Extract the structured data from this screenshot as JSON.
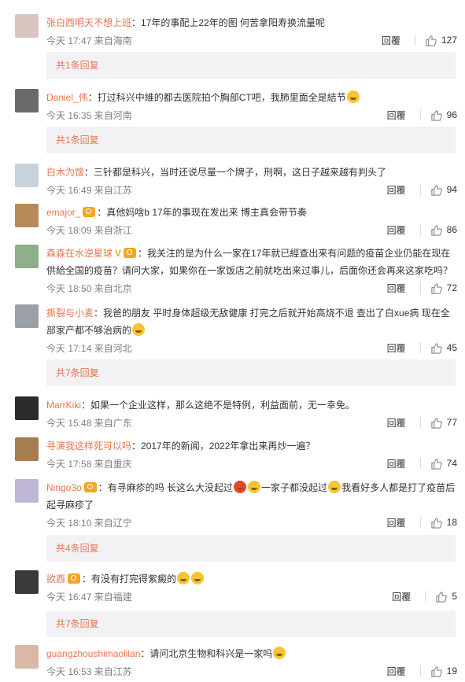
{
  "comments": [
    {
      "user": "张白西明天不想上班",
      "text": "：17年的事配上22年的图 何苦拿阳寿换流量呢",
      "time": "今天 17:47 来自海南",
      "reply": "回覆",
      "likes": "127",
      "more": "共1条回复"
    },
    {
      "user": "Daniel_伟",
      "text": "：打过科兴中維的都去医院拍个胸部CT吧，我肺里面全是結节",
      "time": "今天 16:35 来自河南",
      "reply": "回覆",
      "likes": "96",
      "more": "共1条回复"
    },
    {
      "user": "白木为馊",
      "text": "：三针都是科兴，当时还说尽量一个牌子，刑啊，这日子越来越有判头了",
      "time": "今天 16:49 来自江苏",
      "reply": "回覆",
      "likes": "94"
    },
    {
      "user": "emajor_",
      "text": "：真他妈啥b 17年的事现在发出来 博主真会带节奏",
      "time": "今天 18:09 来自浙江",
      "reply": "回覆",
      "likes": "86"
    },
    {
      "user": "森森在水逆星球",
      "text": "：我关注的是为什么一家在17年就已經查出来有问题的疫苗企业仍能在现在供給全国的疫苗？请问大家，如果你在一家饭店之前就吃出来过事儿，后面你还会再来这家吃吗？",
      "time": "今天 18:50 来自北京",
      "reply": "回覆",
      "likes": "72"
    },
    {
      "user": "撕裂与小麦",
      "text": "：我爸的朋友 平时身体超级无敌健康 打完之后就开始高烧不退 查出了白xue病 现在全部家产都不够治病的",
      "time": "今天 17:14 来自河北",
      "reply": "回覆",
      "likes": "45",
      "more": "共7条回复"
    },
    {
      "user": "MarrKiki",
      "text": "：如果一个企业这样，那么这绝不是特例，利益面前，无一幸免。",
      "time": "今天 15:48 来自广东",
      "reply": "回覆",
      "likes": "77"
    },
    {
      "user": "寻演我这样死可以吗",
      "text": "：2017年的新闻，2022年拿出来再炒一遍？",
      "time": "今天 17:58 来自重庆",
      "reply": "回覆",
      "likes": "74"
    },
    {
      "user": "Ningo3o",
      "text": "：有寻麻疹的吗 长这么大没起过",
      "text2": "一家子都没起过",
      "text3": "我看好多人都是打了疫苗后起寻麻疹了",
      "time": "今天 18:10 来自辽宁",
      "reply": "回覆",
      "likes": "18",
      "more": "共4条回复"
    },
    {
      "user": "欲酉",
      "text": "：有没有打完得紫癜的",
      "time": "今天 16:47 来自福建",
      "reply": "回覆",
      "likes": "5",
      "more": "共7条回复"
    },
    {
      "user": "guangzhoushimaolilan",
      "text": "：请问北京生物和科兴是一家吗",
      "time": "今天 16:53 来自江苏",
      "reply": "回覆",
      "likes": "19"
    }
  ]
}
